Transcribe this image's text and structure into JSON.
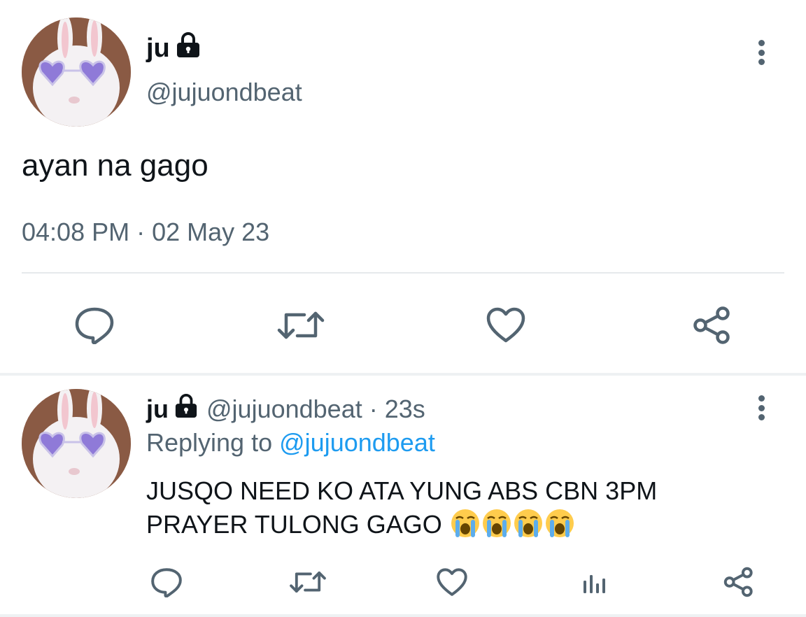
{
  "main_tweet": {
    "display_name": "ju",
    "handle": "@jujuondbeat",
    "text": "ayan na gago",
    "timestamp": "04:08 PM · 02 May 23",
    "actions": [
      "reply-icon",
      "retweet-icon",
      "like-icon",
      "share-icon"
    ],
    "protected_icon": "lock-icon",
    "more_icon": "more-vertical-icon"
  },
  "reply_tweet": {
    "display_name": "ju",
    "handle": "@jujuondbeat",
    "age": "· 23s",
    "replying_prefix": "Replying to",
    "replying_to": "@jujuondbeat",
    "text_line1": "JUSQO NEED KO ATA YUNG ABS CBN 3PM",
    "text_line2": "PRAYER TULONG GAGO",
    "emojis": [
      "loudly-crying-face",
      "loudly-crying-face",
      "loudly-crying-face",
      "loudly-crying-face"
    ],
    "actions": [
      "reply-icon",
      "retweet-icon",
      "like-icon",
      "analytics-icon",
      "share-icon"
    ]
  },
  "colors": {
    "text": "#0f1419",
    "secondary": "#536471",
    "link": "#1d9bf0",
    "divider": "#e6e9ec"
  }
}
